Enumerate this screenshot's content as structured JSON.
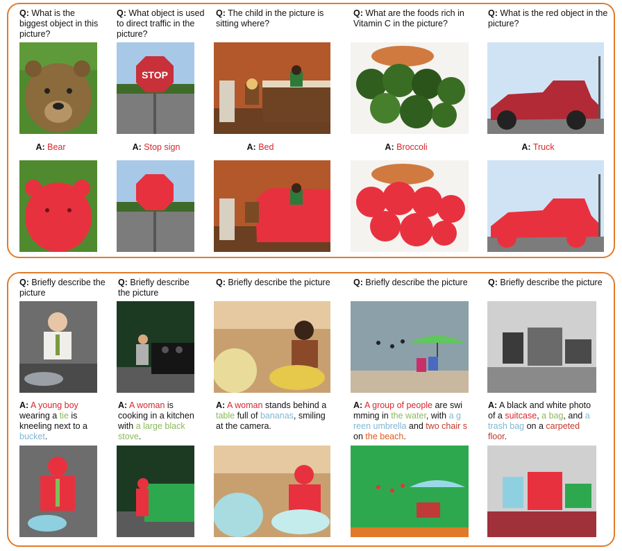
{
  "top": {
    "q_prefix": "Q:",
    "a_prefix": "A:",
    "columns": [
      {
        "question": "What is the biggest object in this picture?",
        "answer": "Bear"
      },
      {
        "question": "What object is used to direct traffic in the picture?",
        "answer": "Stop sign"
      },
      {
        "question": "The child in the picture is sitting where?",
        "answer": "Bed"
      },
      {
        "question": " What are the foods rich in Vitamin C in the picture?",
        "answer": "Broccoli"
      },
      {
        "question": "What is the red object in the picture?",
        "answer": "Truck"
      }
    ]
  },
  "bottom": {
    "q_prefix": "Q:",
    "a_prefix": "A:",
    "question": "Briefly describe the picture",
    "answers": [
      {
        "parts": [
          "A young boy",
          " wearing a ",
          "tie",
          " is kneeling next to a ",
          "bucket",
          "."
        ]
      },
      {
        "parts": [
          "A woman",
          " is cooking in a kitchen with ",
          "a large black stove",
          "."
        ]
      },
      {
        "parts": [
          "A woman",
          " stands behind a ",
          "table",
          " full of ",
          "bananas",
          ", smiling at the camera."
        ]
      },
      {
        "parts": [
          "A group of people",
          " are swi mming in ",
          "the water",
          ", with ",
          "a g reen umbrella",
          " and ",
          "two chair s",
          " on ",
          "the beach",
          "."
        ]
      },
      {
        "parts": [
          "A black and white photo of a ",
          "suitcase",
          ", ",
          "a bag",
          ", and ",
          "a trash bag",
          " on a ",
          "carpeted floor",
          "."
        ]
      }
    ]
  },
  "colors": {
    "frame": "#e07b2a",
    "answer_red": "#d9252b",
    "mask_red": "#e8313f",
    "mask_green": "#2ea84e",
    "mask_blue": "#8fd0e0"
  }
}
